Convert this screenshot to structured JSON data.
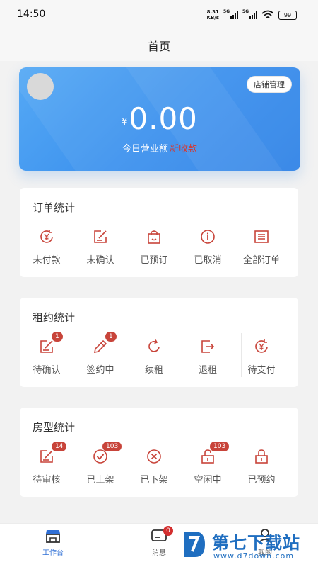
{
  "status_bar": {
    "time": "14:50",
    "net_speed_value": "8.31",
    "net_speed_unit": "KB/s",
    "signal_1": "5G",
    "signal_2": "5G",
    "battery": "99"
  },
  "nav": {
    "title": "首页"
  },
  "hero": {
    "shop_button": "店铺管理",
    "currency": "¥",
    "amount": "0.00",
    "label": "今日营业额",
    "hint": "新收款"
  },
  "orders": {
    "title": "订单统计",
    "items": [
      {
        "label": "未付款",
        "icon": "yen-refresh-icon"
      },
      {
        "label": "未确认",
        "icon": "edit-doc-icon"
      },
      {
        "label": "已预订",
        "icon": "bag-icon"
      },
      {
        "label": "已取消",
        "icon": "info-circle-icon"
      },
      {
        "label": "全部订单",
        "icon": "list-icon"
      }
    ]
  },
  "lease": {
    "title": "租约统计",
    "items": [
      {
        "label": "待确认",
        "icon": "edit-doc-icon",
        "badge": "1"
      },
      {
        "label": "签约中",
        "icon": "pencil-icon",
        "badge": "1"
      },
      {
        "label": "续租",
        "icon": "refresh-icon"
      },
      {
        "label": "退租",
        "icon": "exit-icon"
      },
      {
        "label": "待支付",
        "icon": "yen-refresh-icon"
      }
    ]
  },
  "rooms": {
    "title": "房型统计",
    "items": [
      {
        "label": "待审核",
        "icon": "edit-doc-icon",
        "badge": "14"
      },
      {
        "label": "已上架",
        "icon": "check-circle-icon",
        "badge": "103"
      },
      {
        "label": "已下架",
        "icon": "x-circle-icon"
      },
      {
        "label": "空闲中",
        "icon": "unlock-icon",
        "badge": "103"
      },
      {
        "label": "已预约",
        "icon": "lock-icon"
      }
    ]
  },
  "tabbar": {
    "tabs": [
      {
        "label": "工作台",
        "active": true
      },
      {
        "label": "消息",
        "badge": "0"
      },
      {
        "label": "我的"
      }
    ]
  },
  "watermark": {
    "name": "第七下载站",
    "url": "www.d7down.com"
  },
  "colors": {
    "accent": "#c8443a",
    "hero_blue": "#3d92ee",
    "active_tab": "#2f6fd6"
  }
}
